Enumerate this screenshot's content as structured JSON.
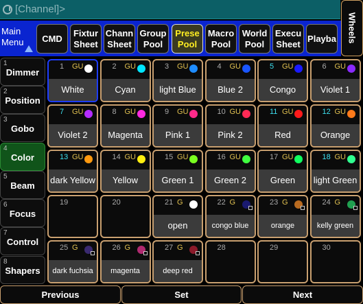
{
  "command_line": {
    "text": "[Channel]>"
  },
  "wheels_label": "Wheels",
  "toolbar": {
    "main_menu": "Main Menu",
    "buttons": [
      {
        "label": "CMD"
      },
      {
        "label": "Fixtur\nSheet"
      },
      {
        "label": "Chann\nSheet"
      },
      {
        "label": "Group\nPool"
      },
      {
        "label": "Prese\nPool",
        "active": true
      },
      {
        "label": "Macro\nPool"
      },
      {
        "label": "World\nPool"
      },
      {
        "label": "Execu\nSheet"
      },
      {
        "label": "Playba"
      }
    ]
  },
  "sidebar": [
    {
      "num": "1",
      "label": "Dimmer"
    },
    {
      "num": "2",
      "label": "Position"
    },
    {
      "num": "3",
      "label": "Gobo"
    },
    {
      "num": "4",
      "label": "Color",
      "active": true
    },
    {
      "num": "5",
      "label": "Beam"
    },
    {
      "num": "6",
      "label": "Focus"
    },
    {
      "num": "7",
      "label": "Control"
    },
    {
      "num": "8",
      "label": "Shapers"
    }
  ],
  "presets": [
    {
      "num": "1",
      "tag": "GU",
      "name": "White",
      "color": "#ffffff",
      "selected": true
    },
    {
      "num": "2",
      "tag": "GU",
      "name": "Cyan",
      "color": "#00e5ff"
    },
    {
      "num": "3",
      "tag": "GU",
      "name": "light Blue",
      "color": "#1e8cff"
    },
    {
      "num": "4",
      "tag": "GU",
      "name": "Blue 2",
      "color": "#1a56ff"
    },
    {
      "num": "5",
      "tag": "GU",
      "name": "Congo",
      "color": "#1a1aff",
      "cyan_num": true
    },
    {
      "num": "6",
      "tag": "GU",
      "name": "Violet 1",
      "color": "#8a2aff"
    },
    {
      "num": "7",
      "tag": "GU",
      "name": "Violet 2",
      "color": "#b52cff",
      "cyan_num": true
    },
    {
      "num": "8",
      "tag": "GU",
      "name": "Magenta",
      "color": "#ff2ae0"
    },
    {
      "num": "9",
      "tag": "GU",
      "name": "Pink 1",
      "color": "#ff2a8a"
    },
    {
      "num": "10",
      "tag": "GU",
      "name": "Pink 2",
      "color": "#ff2a55"
    },
    {
      "num": "11",
      "tag": "GU",
      "name": "Red",
      "color": "#ff1a1a",
      "cyan_num": true
    },
    {
      "num": "12",
      "tag": "GU",
      "name": "Orange",
      "color": "#ff7a1a",
      "cyan_num": true
    },
    {
      "num": "13",
      "tag": "GU",
      "name": "dark Yellow",
      "color": "#ff9a10",
      "cyan_num": true
    },
    {
      "num": "14",
      "tag": "GU",
      "name": "Yellow",
      "color": "#ffee10"
    },
    {
      "num": "15",
      "tag": "GU",
      "name": "Green 1",
      "color": "#7aff20"
    },
    {
      "num": "16",
      "tag": "GU",
      "name": "Green 2",
      "color": "#40ff40"
    },
    {
      "num": "17",
      "tag": "GU",
      "name": "Green",
      "color": "#10ff60"
    },
    {
      "num": "18",
      "tag": "GU",
      "name": "light Green",
      "color": "#30ff90",
      "cyan_num": true
    },
    {
      "num": "19",
      "tag": "",
      "name": "",
      "color": ""
    },
    {
      "num": "20",
      "tag": "",
      "name": "",
      "color": ""
    },
    {
      "num": "21",
      "tag": "G",
      "name": "open",
      "color": "#ffffff"
    },
    {
      "num": "22",
      "tag": "G",
      "name": "congo blue",
      "color": "#1a1a70",
      "small": true
    },
    {
      "num": "23",
      "tag": "G",
      "name": "orange",
      "color": "#b86a20",
      "small": true
    },
    {
      "num": "24",
      "tag": "G",
      "name": "kelly green",
      "color": "#20a050",
      "small": true
    },
    {
      "num": "25",
      "tag": "G",
      "name": "dark fuchsia",
      "color": "#3a2a70",
      "small": true
    },
    {
      "num": "26",
      "tag": "G",
      "name": "magenta",
      "color": "#b02a70",
      "small": true
    },
    {
      "num": "27",
      "tag": "G",
      "name": "deep red",
      "color": "#8a1a2a",
      "small": true
    },
    {
      "num": "28",
      "tag": "",
      "name": "",
      "color": ""
    },
    {
      "num": "29",
      "tag": "",
      "name": "",
      "color": ""
    },
    {
      "num": "30",
      "tag": "",
      "name": "",
      "color": ""
    }
  ],
  "bottom": {
    "previous": "Previous",
    "set": "Set",
    "next": "Next"
  }
}
